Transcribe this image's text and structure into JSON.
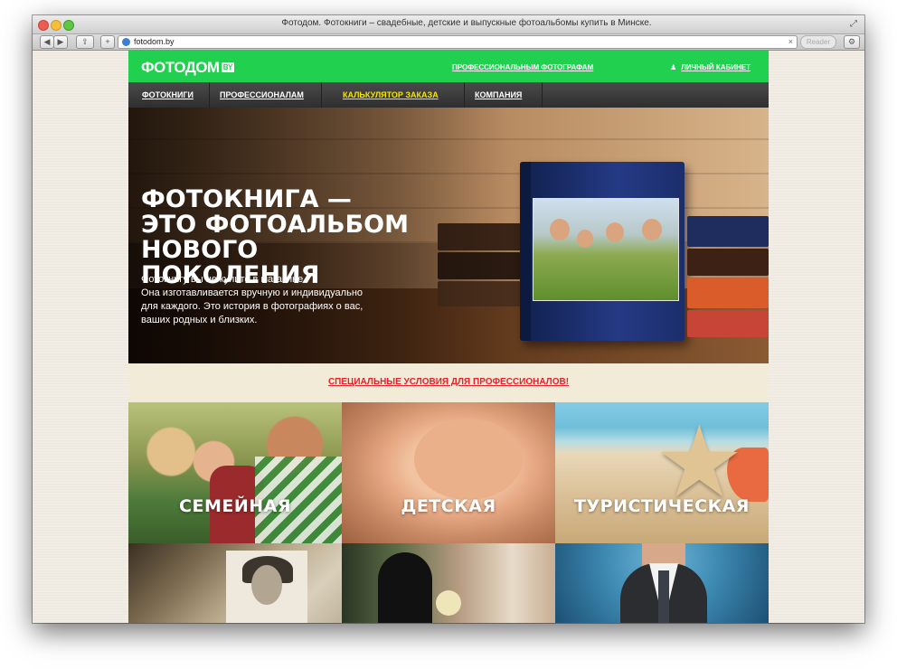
{
  "window": {
    "title": "Фотодом. Фотокниги – свадебные, детские и выпускные фотоальбомы купить в Минске.",
    "url": "fotodom.by",
    "reader_label": "Reader"
  },
  "icons": {
    "back": "◀",
    "forward": "▶",
    "share": "share-icon",
    "add": "+",
    "close": "×",
    "gear": "⚙",
    "resize": "⤢",
    "user": "👤"
  },
  "site": {
    "logo": "ФОТОДОМ",
    "logo_badge": "BY",
    "pro_link": "ПРОФЕССИОНАЛЬНЫМ ФОТОГРАФАМ",
    "account_link": "ЛИЧНЫЙ КАБИНЕТ",
    "nav": [
      {
        "label": "ФОТОКНИГИ"
      },
      {
        "label": "ПРОФЕССИОНАЛАМ"
      },
      {
        "label": "КАЛЬКУЛЯТОР ЗАКАЗА"
      },
      {
        "label": "КОМПАНИЯ"
      }
    ],
    "hero": {
      "title_line1": "ФОТОКНИГА —",
      "title_line2": "ЭТО ФОТОАЛЬБОМ",
      "title_line3": "НОВОГО ПОКОЛЕНИЯ",
      "text_line1": "Фотокнигу вы не купите в магазине.",
      "text_line2": "Она изготавливается вручную и индивидуально",
      "text_line3": "для каждого. Это история в фотографиях о вас,",
      "text_line4": "ваших родных и близких."
    },
    "promo": "СПЕЦИАЛЬНЫЕ УСЛОВИЯ ДЛЯ ПРОФЕССИОНАЛОВ!",
    "tiles": [
      {
        "label": "СЕМЕЙНАЯ"
      },
      {
        "label": "ДЕТСКАЯ"
      },
      {
        "label": "ТУРИСТИЧЕСКАЯ"
      }
    ]
  },
  "colors": {
    "brand_green": "#21d04f",
    "nav_highlight": "#f5e600",
    "promo_red": "#e8202a"
  }
}
